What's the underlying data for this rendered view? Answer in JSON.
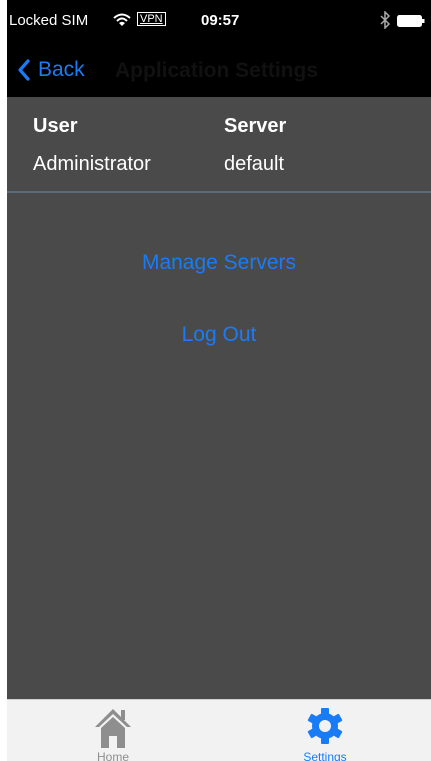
{
  "status_bar": {
    "carrier": "Locked SIM",
    "vpn": "VPN",
    "time": "09:57"
  },
  "nav": {
    "back_label": "Back",
    "title": "Application Settings"
  },
  "info": {
    "user_label": "User",
    "user_value": "Administrator",
    "server_label": "Server",
    "server_value": "default"
  },
  "actions": {
    "manage_servers": "Manage Servers",
    "log_out": "Log Out"
  },
  "tabs": [
    {
      "label": "Home",
      "icon": "home-icon",
      "active": false
    },
    {
      "label": "Settings",
      "icon": "gear-icon",
      "active": true
    }
  ],
  "colors": {
    "accent": "#1a7cf5",
    "content_bg": "#4a4a4a",
    "inactive_tab": "#8e8e8e"
  }
}
